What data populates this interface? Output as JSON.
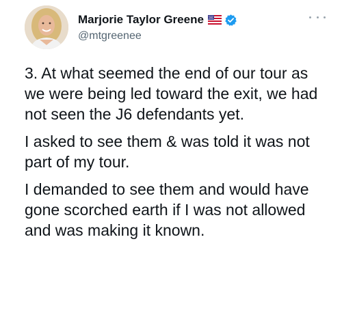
{
  "author": {
    "display_name": "Marjorie Taylor Greene",
    "handle": "@mtgreenee",
    "avatar_icon": "profile-photo",
    "flag_icon": "us-flag-icon",
    "verified_icon": "verified-badge-icon",
    "verified_color": "#1d9bf0"
  },
  "menu": {
    "more_icon": "more-options-icon"
  },
  "tweet": {
    "paragraphs": [
      "3. At what seemed the end of our tour as we were being led toward the exit, we had not seen the J6 defendants yet.",
      "I asked to see them & was told it was not part of my tour.",
      "I demanded to see them and would have gone scorched earth if I was not allowed and was making it known."
    ]
  }
}
